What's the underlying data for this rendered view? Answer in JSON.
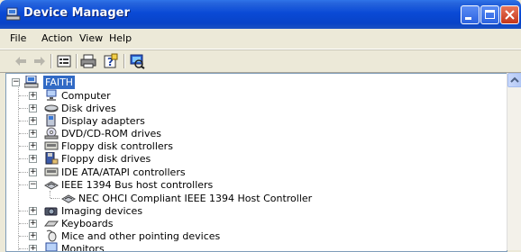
{
  "window": {
    "title": "Device Manager"
  },
  "menu": [
    "File",
    "Action",
    "View",
    "Help"
  ],
  "toolbar": {
    "icons": [
      "back-arrow-icon",
      "forward-arrow-icon",
      "properties-icon",
      "print-icon",
      "help-icon",
      "scan-hardware-icon"
    ]
  },
  "tree": {
    "root": "FAITH",
    "items": [
      {
        "label": "Computer",
        "icon": "computer-icon",
        "expanded": false
      },
      {
        "label": "Disk drives",
        "icon": "disk-drive-icon",
        "expanded": false
      },
      {
        "label": "Display adapters",
        "icon": "display-adapter-icon",
        "expanded": false
      },
      {
        "label": "DVD/CD-ROM drives",
        "icon": "cdrom-icon",
        "expanded": false
      },
      {
        "label": "Floppy disk controllers",
        "icon": "controller-icon",
        "expanded": false
      },
      {
        "label": "Floppy disk drives",
        "icon": "floppy-icon",
        "expanded": false
      },
      {
        "label": "IDE ATA/ATAPI controllers",
        "icon": "controller-icon",
        "expanded": false
      },
      {
        "label": "IEEE 1394 Bus host controllers",
        "icon": "ieee1394-icon",
        "expanded": true,
        "children": [
          {
            "label": "NEC OHCI Compliant IEEE 1394 Host Controller",
            "icon": "ieee1394-icon"
          }
        ]
      },
      {
        "label": "Imaging devices",
        "icon": "camera-icon",
        "expanded": false
      },
      {
        "label": "Keyboards",
        "icon": "keyboard-icon",
        "expanded": false
      },
      {
        "label": "Mice and other pointing devices",
        "icon": "mouse-icon",
        "expanded": false
      },
      {
        "label": "Monitors",
        "icon": "monitor-icon",
        "expanded": false
      }
    ]
  },
  "colors": {
    "titlebar": "#0a4ad6",
    "selection": "#316ac5",
    "tree_border": "#7f9db9"
  }
}
